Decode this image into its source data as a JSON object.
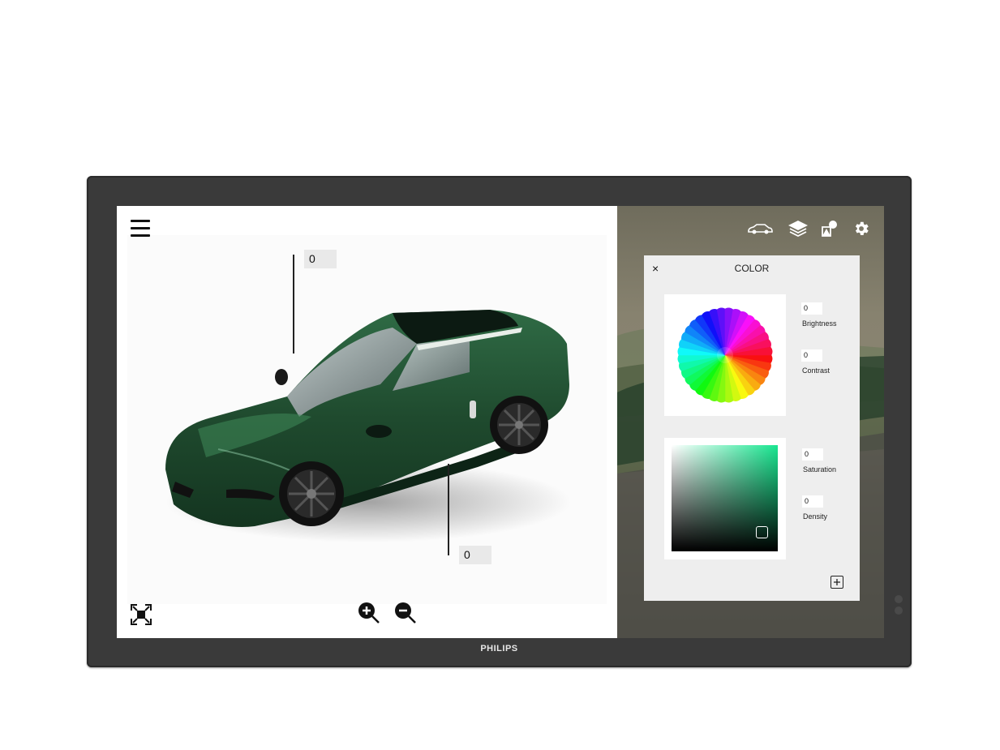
{
  "monitor": {
    "brand": "PHILIPS"
  },
  "viewer": {
    "callout_top_value": "0",
    "callout_bottom_value": "0",
    "car_color": "#1f4a2e"
  },
  "icons": {
    "menu": "hamburger-icon",
    "fullscreen": "fullscreen-icon",
    "zoom_in": "zoom-in-icon",
    "zoom_out": "zoom-out-icon",
    "toolbar": [
      "car-icon",
      "layers-icon",
      "shapes-icon",
      "gear-icon"
    ]
  },
  "color_panel": {
    "title": "COLOR",
    "close": "×",
    "brightness": {
      "label": "Brightness",
      "value": "0"
    },
    "contrast": {
      "label": "Contrast",
      "value": "0"
    },
    "saturation": {
      "label": "Saturation",
      "value": "0"
    },
    "density": {
      "label": "Density",
      "value": "0"
    },
    "hue_color": "#18e690"
  }
}
